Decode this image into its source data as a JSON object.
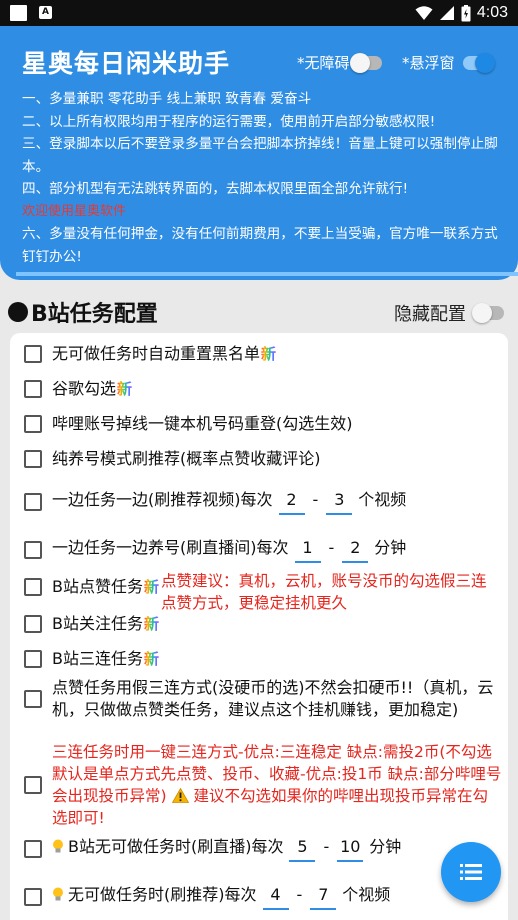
{
  "status_bar": {
    "time": "4:03",
    "app_icon_letter": "A"
  },
  "header": {
    "title": "星奥每日闲米助手",
    "toggles": [
      {
        "label": "*无障碍",
        "state": "off"
      },
      {
        "label": "*悬浮窗",
        "state": "on"
      }
    ],
    "notices": [
      "一、多量兼职 零花助手 线上兼职 致青春 爱奋斗",
      "二、以上所有权限均用于程序的运行需要，使用前开启部分敏感权限!",
      "三、登录脚本以后不要登录多量平台会把脚本挤掉线！音量上键可以强制停止脚本。",
      "四、部分机型有无法跳转界面的，去脚本权限里面全部允许就行!",
      "欢迎使用星奥软件",
      "六、多量没有任何押金，没有任何前期费用，不要上当受骗，官方唯一联系方式钉钉办公!"
    ],
    "colors": {
      "header_bg": "#2f8ee4",
      "accent": "#2196f3",
      "warning_red": "#e5261e"
    }
  },
  "section": {
    "title": "B站任务配置",
    "hide_label": "隐藏配置",
    "hide_state": "off"
  },
  "badge_text": "新",
  "tasks": {
    "r1": {
      "text": "无可做任务时自动重置黑名单"
    },
    "r2": {
      "text": "谷歌勾选"
    },
    "r3": {
      "text": "哔哩账号掉线一键本机号码重登(勾选生效)"
    },
    "r4": {
      "text": "纯养号模式刷推荐(概率点赞收藏评论)"
    },
    "r5": {
      "prefix": "一边任务一边(刷推荐视频)每次",
      "min": "2",
      "dash": "-",
      "max": "3",
      "unit": "个视频"
    },
    "r6": {
      "prefix": "一边任务一边养号(刷直播间)每次",
      "min": "1",
      "dash": "-",
      "max": "2",
      "unit": "分钟"
    },
    "r7": {
      "text": "B站点赞任务",
      "note": "点赞建议：真机，云机，账号没币的勾选假三连点赞方式，更稳定挂机更久"
    },
    "r8": {
      "text": "B站关注任务"
    },
    "r9": {
      "text": "B站三连任务"
    },
    "r10": {
      "text": "点赞任务用假三连方式(没硬币的选)不然会扣硬币!!（真机，云机，只做做点赞类任务，建议点这个挂机赚钱，更加稳定)"
    },
    "r11": {
      "text_a": "三连任务时用一键三连方式-优点:三连稳定 缺点:需投2币(不勾选默认是单点方式先点赞、投币、收藏-优点:投1币 缺点:部分哔哩号会出现投币异常)",
      "text_b": "建议不勾选如果你的哔哩出现投币异常在勾选即可!"
    },
    "r12": {
      "prefix": "B站无可做任务时(刷直播)每次",
      "min": "5",
      "dash": "-",
      "max": "10",
      "unit": "分钟"
    },
    "r13": {
      "prefix": "无可做任务时(刷推荐)每次",
      "min": "4",
      "dash": "-",
      "max": "7",
      "unit": "个视频"
    }
  },
  "icons": {
    "fab": "list-icon",
    "bulb": "lightbulb-icon",
    "warning": "warning-icon"
  }
}
